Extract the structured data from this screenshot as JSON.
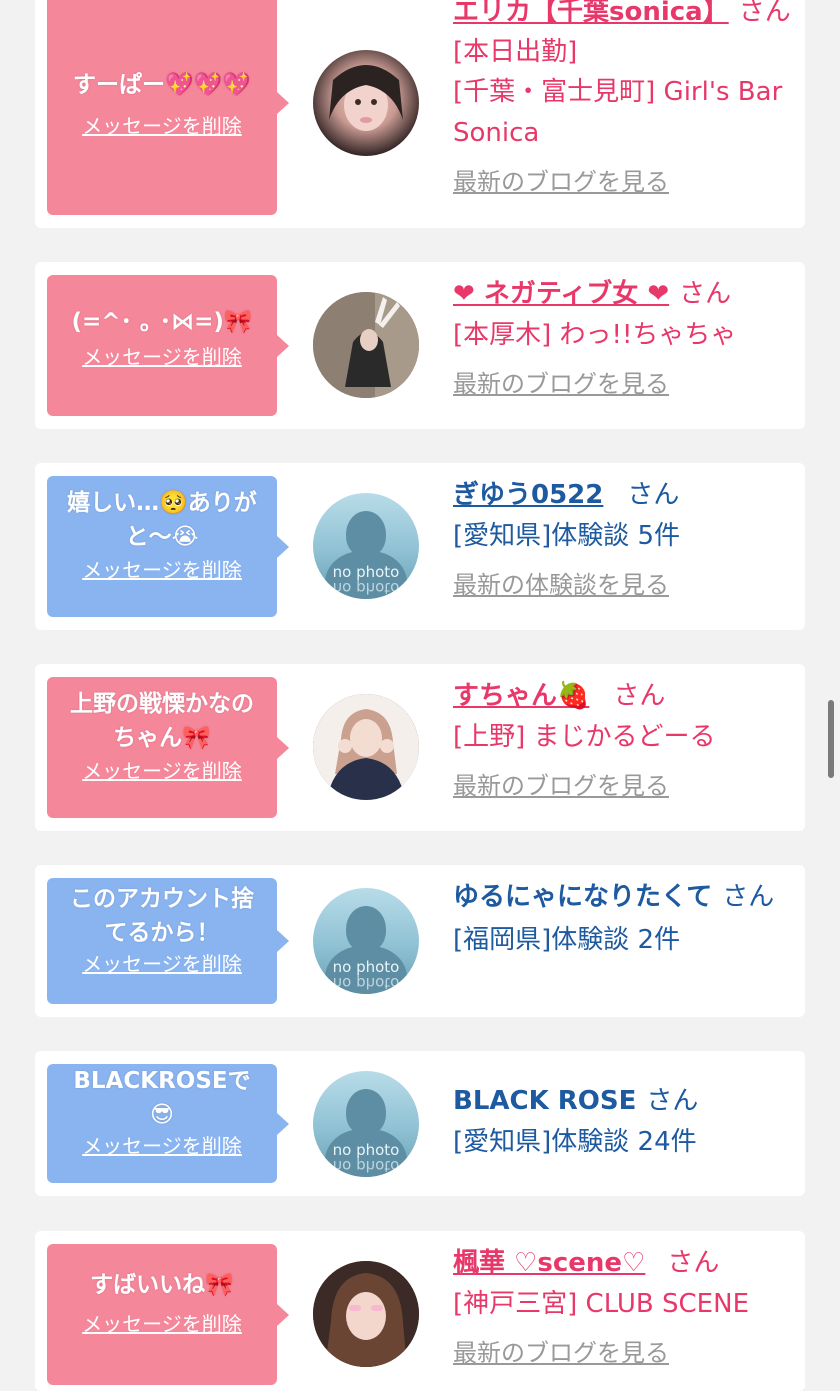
{
  "items": [
    {
      "bubble_text": "すーぱー💖💖💖",
      "delete_label": "メッセージを削除",
      "name": "エリカ【千葉sonica】",
      "san": "さん",
      "details": [
        "[本日出勤]",
        "[千葉・富士見町] Girl's Bar Sonica"
      ],
      "link": "最新のブログを見る",
      "bubble_color": "pink",
      "avatar_icon": "user-photo"
    },
    {
      "bubble_text": "(=^･ ｡ ･⋈=)🎀",
      "delete_label": "メッセージを削除",
      "name": "❤ ネガティブ女 ❤",
      "san": "さん",
      "details": [
        "[本厚木] わっ!!ちゃちゃ"
      ],
      "link": "最新のブログを見る",
      "bubble_color": "pink",
      "avatar_icon": "user-photo"
    },
    {
      "bubble_text": "嬉しい…🥺ありがと〜😭",
      "delete_label": "メッセージを削除",
      "name": "ぎゆう0522",
      "san": "さん",
      "details": [
        "[愛知県]体験談 5件"
      ],
      "link": "最新の体験談を見る",
      "bubble_color": "blue",
      "avatar_text": "no photo"
    },
    {
      "bubble_text": "上野の戦慄かなのちゃん🎀",
      "delete_label": "メッセージを削除",
      "name": "すちゃん🍓",
      "san": "さん",
      "details": [
        "[上野] まじかるどーる"
      ],
      "link": "最新のブログを見る",
      "bubble_color": "pink",
      "avatar_icon": "user-photo"
    },
    {
      "bubble_text": "このアカウント捨てるから！",
      "delete_label": "メッセージを削除",
      "name": "ゆるにゃになりたくて",
      "san": "さん",
      "details": [
        "[福岡県]体験談 2件"
      ],
      "bubble_color": "blue",
      "avatar_text": "no photo"
    },
    {
      "bubble_text": "BLACKROSEで😎",
      "delete_label": "メッセージを削除",
      "name": "BLACK ROSE",
      "san": "さん",
      "details": [
        "[愛知県]体験談 24件"
      ],
      "bubble_color": "blue",
      "avatar_text": "no photo"
    },
    {
      "bubble_text": "すばいいね🎀",
      "delete_label": "メッセージを削除",
      "name": "楓華 ♡scene♡",
      "san": "さん",
      "details": [
        "[神戸三宮] CLUB SCENE"
      ],
      "link": "最新のブログを見る",
      "bubble_color": "pink",
      "avatar_icon": "user-photo"
    }
  ],
  "colors": {
    "pink_bubble": "#f5879b",
    "blue_bubble": "#8ab4f0",
    "pink_text": "#e8386a",
    "blue_text": "#1e5aa0",
    "link_gray": "#999999"
  }
}
